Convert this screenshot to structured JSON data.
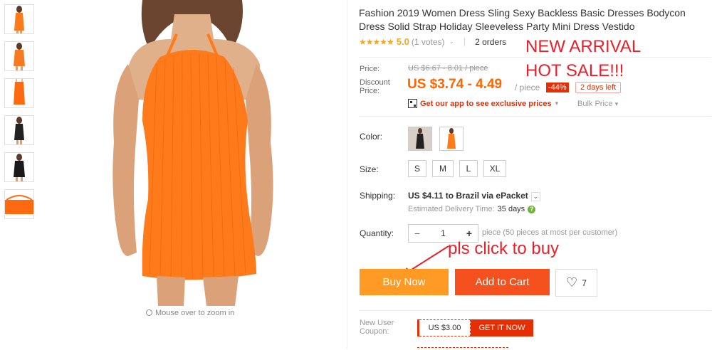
{
  "product": {
    "title": "Fashion 2019 Women Dress Sling Sexy Backless Basic Dresses Bodycon Dress Solid Strap Holiday Sleeveless Party Mini Dress Vestido",
    "stars": "★★★★★",
    "score": "5.0",
    "votes": "(1 votes)",
    "orders": "2 orders"
  },
  "overlay": {
    "new_arrival": "NEW ARRIVAL",
    "hot_sale": "HOT SALE!!!",
    "pls_click": "pls click to buy"
  },
  "gallery": {
    "zoom_hint": "Mouse over to zoom in",
    "thumbnails": [
      "orange-dress",
      "orange-dress",
      "orange-dress-flat",
      "black-dress",
      "black-dress",
      "orange-dress-fabric"
    ]
  },
  "pricing": {
    "price_label": "Price:",
    "old_price": "US $6.67 - 8.01 / piece",
    "discount_label_1": "Discount",
    "discount_label_2": "Price:",
    "discount_price": "US $3.74 - 4.49",
    "per_piece": "/ piece",
    "off": "-44%",
    "days_left": "2 days left",
    "app_promo": "Get our app to see exclusive prices",
    "bulk_price": "Bulk Price"
  },
  "options": {
    "color_label": "Color:",
    "size_label": "Size:",
    "sizes": [
      "S",
      "M",
      "L",
      "XL"
    ],
    "shipping_label": "Shipping:",
    "shipping_cost": "US $4.11",
    "shipping_to": "to Brazil via ePacket",
    "delivery_label": "Estimated Delivery Time:",
    "delivery_days": "35 days",
    "quantity_label": "Quantity:",
    "quantity_value": "1",
    "quantity_note": "piece (50 pieces at most per customer)"
  },
  "actions": {
    "buy_now": "Buy Now",
    "add_to_cart": "Add to Cart",
    "wishlist_count": "7"
  },
  "coupon": {
    "label_1": "New User",
    "label_2": "Coupon:",
    "value": "US $3.00",
    "get": "GET IT NOW"
  },
  "colors": {
    "accent": "#f60",
    "buy": "#ff9a25",
    "cart": "#f4511e",
    "red": "#e62e04",
    "overlay_red": "#e8202a"
  }
}
